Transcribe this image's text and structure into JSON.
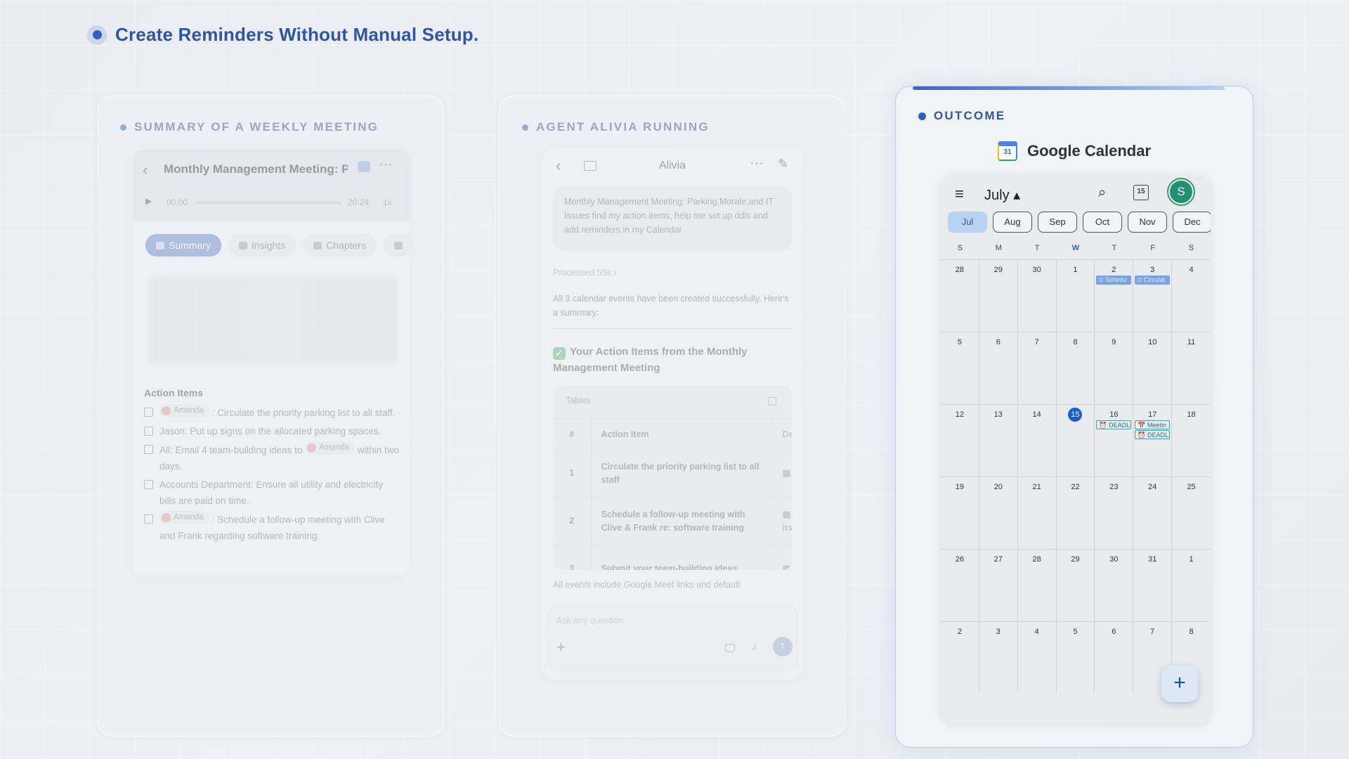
{
  "headline": "Create Reminders Without Manual Setup.",
  "panels": {
    "summary": {
      "title": "SUMMARY OF A WEEKLY MEETING",
      "meeting_title": "Monthly Management Meeting: Parking",
      "time_current": "00:00",
      "time_total": "20:24",
      "speed": "1x",
      "tabs": [
        "Summary",
        "Insights",
        "Chapters"
      ],
      "active_tab": "Summary",
      "action_items_title": "Action Items",
      "action_items": [
        {
          "mention": "Amanda",
          "text": ": Circulate the priority parking list to all staff."
        },
        {
          "mention": "",
          "text": "Jason: Put up signs on the allocated parking spaces."
        },
        {
          "mention": "",
          "text": "All: Email 4 team-building ideas to",
          "mention_after": "Amanda",
          "text_after": "within two days."
        },
        {
          "mention": "",
          "text": "Accounts Department: Ensure all utility and electricity bills are paid on time."
        },
        {
          "mention": "Amanda",
          "text": ": Schedule a follow-up meeting with Clive and Frank regarding software training."
        }
      ]
    },
    "agent": {
      "title": "AGENT ALIVIA RUNNING",
      "chat_name": "Alivia",
      "user_message": "Monthly Management Meeting: Parking,Morale,and IT Issues find my action items, help me set up ddls and add reminders in my Calendar",
      "processed": "Processed 55s ›",
      "intro": "All 3 calendar events have been created successfully. Here's a summary:",
      "heading": "Your Action Items from the Monthly Management Meeting",
      "tables_label": "Tables",
      "table_headers": [
        "#",
        "Action Item",
        "De"
      ],
      "table_rows": [
        {
          "n": "1",
          "item": "Circulate the priority parking list to all staff",
          "extra": ""
        },
        {
          "n": "2",
          "item": "Schedule a follow-up meeting with Clive & Frank re: software training",
          "extra": "itsc"
        },
        {
          "n": "3",
          "item": "Submit your team-building ideas",
          "extra": ""
        }
      ],
      "footnote": "All events include Google Meet links and default",
      "input_placeholder": "Ask any question"
    },
    "outcome": {
      "title": "OUTCOME",
      "app_name": "Google Calendar",
      "logo_text": "31",
      "month": "July ▴",
      "calendar_icon_text": "15",
      "avatar_letter": "S",
      "months": [
        "Jul",
        "Aug",
        "Sep",
        "Oct",
        "Nov",
        "Dec"
      ],
      "selected_month": "Jul",
      "weekdays": [
        "S",
        "M",
        "T",
        "W",
        "T",
        "F",
        "S"
      ],
      "weeks": [
        [
          "28",
          "29",
          "30",
          "1",
          "2",
          "3",
          "4"
        ],
        [
          "5",
          "6",
          "7",
          "8",
          "9",
          "10",
          "11"
        ],
        [
          "12",
          "13",
          "14",
          "15",
          "16",
          "17",
          "18"
        ],
        [
          "19",
          "20",
          "21",
          "22",
          "23",
          "24",
          "25"
        ],
        [
          "26",
          "27",
          "28",
          "29",
          "30",
          "31",
          "1"
        ],
        [
          "2",
          "3",
          "4",
          "5",
          "6",
          "7",
          "8"
        ]
      ],
      "today": "15",
      "events": [
        {
          "week": 0,
          "day": 4,
          "label": "⏲ Schedu",
          "style": "blue",
          "slot": 0
        },
        {
          "week": 0,
          "day": 5,
          "label": "⏲ Circulat",
          "style": "blue",
          "slot": 0
        },
        {
          "week": 2,
          "day": 4,
          "label": "⏰ DEADL",
          "style": "teal",
          "slot": 0
        },
        {
          "week": 2,
          "day": 5,
          "label": "📅 Meetin",
          "style": "teal",
          "slot": 0
        },
        {
          "week": 2,
          "day": 5,
          "label": "⏰ DEADL",
          "style": "teal",
          "slot": 1
        }
      ],
      "fab_label": "+"
    }
  },
  "colors": {
    "accent": "#2f5fc4",
    "headline": "#2e56a8",
    "today": "#1a5fd0",
    "selected_month_bg": "#b8d3f2"
  }
}
